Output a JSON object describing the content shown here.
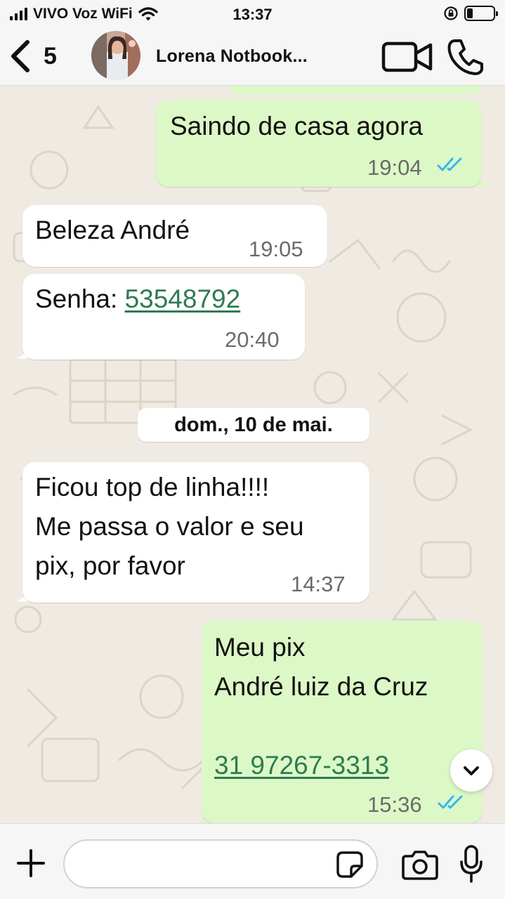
{
  "status_bar": {
    "carrier": "VIVO Voz WiFi",
    "time": "13:37"
  },
  "header": {
    "back_count": "5",
    "contact_name": "Lorena Notbook..."
  },
  "messages": [
    {
      "direction": "outgoing",
      "text": "Saindo de casa agora",
      "time": "19:04",
      "read": true
    },
    {
      "direction": "incoming",
      "text": "Beleza André",
      "time": "19:05"
    },
    {
      "direction": "incoming",
      "text_prefix": "Senha: ",
      "link": "53548792",
      "time": "20:40"
    },
    {
      "direction": "incoming",
      "lines": [
        "Ficou top de linha!!!!",
        "Me passa o valor e seu",
        "pix, por favor"
      ],
      "time": "14:37"
    },
    {
      "direction": "outgoing",
      "lines": [
        "Meu pix",
        "André luiz da Cruz"
      ],
      "link": "31 97267-3313",
      "time": "15:36",
      "read": true
    }
  ],
  "date_divider": "dom., 10 de mai.",
  "input": {
    "placeholder": ""
  },
  "colors": {
    "outgoing_bubble": "#dcf8c6",
    "incoming_bubble": "#ffffff",
    "chat_background": "#efeae2",
    "read_ticks": "#34b7f1",
    "link": "#2f7a53"
  },
  "icons": [
    "signal-icon",
    "wifi-icon",
    "rotation-lock-icon",
    "battery-icon",
    "back-chevron-icon",
    "video-camera-icon",
    "phone-icon",
    "double-check-icon",
    "chevron-down-icon",
    "plus-icon",
    "sticker-icon",
    "camera-icon",
    "microphone-icon"
  ]
}
